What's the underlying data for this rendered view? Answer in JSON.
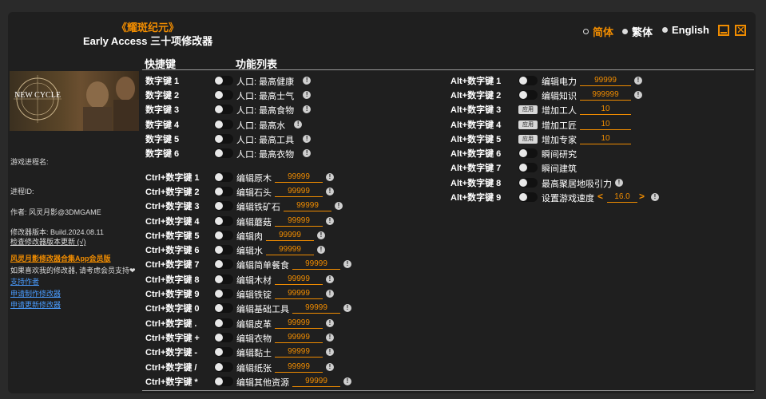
{
  "app": {
    "title_cn": "《耀斑纪元》",
    "subtitle": "Early Access 三十项修改器"
  },
  "languages": [
    {
      "label": "简体",
      "selected": true
    },
    {
      "label": "繁体",
      "selected": false
    },
    {
      "label": "English",
      "selected": false
    }
  ],
  "headers": {
    "hotkey": "快捷键",
    "features": "功能列表"
  },
  "cover": {
    "text": "NEW CYCLE"
  },
  "sidebar": {
    "process_name": "游戏进程名:",
    "process_id": "进程ID:",
    "author": "作者: 风灵月影@3DMGAME",
    "version": "修改器版本: Build.2024.08.11",
    "check_update": "检查修改器版本更新 (√)",
    "app_link": "风灵月影修改器合集App会员版",
    "support_text": "如果喜欢我的修改器, 请考虑会员支持❤",
    "support_author": "支持作者",
    "request_trainer": "申请制作修改器",
    "request_update": "申请更新修改器"
  },
  "left_rows": [
    {
      "key": "数字键 1",
      "name": "人口: 最高健康"
    },
    {
      "key": "数字键 2",
      "name": "人口: 最高士气"
    },
    {
      "key": "数字键 3",
      "name": "人口: 最高食物"
    },
    {
      "key": "数字键 4",
      "name": "人口: 最高水"
    },
    {
      "key": "数字键 5",
      "name": "人口: 最高工具"
    },
    {
      "key": "数字键 6",
      "name": "人口: 最高衣物"
    },
    {
      "key": "Ctrl+数字键 1",
      "name": "编辑原木",
      "value": "99999"
    },
    {
      "key": "Ctrl+数字键 2",
      "name": "编辑石头",
      "value": "99999"
    },
    {
      "key": "Ctrl+数字键 3",
      "name": "编辑铁矿石",
      "value": "99999"
    },
    {
      "key": "Ctrl+数字键 4",
      "name": "编辑蘑菇",
      "value": "99999"
    },
    {
      "key": "Ctrl+数字键 5",
      "name": "编辑肉",
      "value": "99999"
    },
    {
      "key": "Ctrl+数字键 6",
      "name": "编辑水",
      "value": "99999"
    },
    {
      "key": "Ctrl+数字键 7",
      "name": "编辑简单餐食",
      "value": "99999"
    },
    {
      "key": "Ctrl+数字键 8",
      "name": "编辑木材",
      "value": "99999"
    },
    {
      "key": "Ctrl+数字键 9",
      "name": "编辑铁锭",
      "value": "99999"
    },
    {
      "key": "Ctrl+数字键 0",
      "name": "编辑基础工具",
      "value": "99999"
    },
    {
      "key": "Ctrl+数字键 .",
      "name": "编辑皮革",
      "value": "99999"
    },
    {
      "key": "Ctrl+数字键 +",
      "name": "编辑衣物",
      "value": "99999"
    },
    {
      "key": "Ctrl+数字键 -",
      "name": "编辑黏土",
      "value": "99999"
    },
    {
      "key": "Ctrl+数字键 /",
      "name": "编辑纸张",
      "value": "99999"
    },
    {
      "key": "Ctrl+数字键 *",
      "name": "编辑其他资源",
      "value": "99999"
    }
  ],
  "right_rows": [
    {
      "key": "Alt+数字键 1",
      "name": "编辑电力",
      "value": "99999"
    },
    {
      "key": "Alt+数字键 2",
      "name": "编辑知识",
      "value": "999999"
    },
    {
      "key": "Alt+数字键 3",
      "name": "增加工人",
      "value": "10",
      "apply": "应用"
    },
    {
      "key": "Alt+数字键 4",
      "name": "增加工匠",
      "value": "10",
      "apply": "应用"
    },
    {
      "key": "Alt+数字键 5",
      "name": "增加专家",
      "value": "10",
      "apply": "应用"
    },
    {
      "key": "Alt+数字键 6",
      "name": "瞬间研究"
    },
    {
      "key": "Alt+数字键 7",
      "name": "瞬间建筑"
    },
    {
      "key": "Alt+数字键 8",
      "name": "最高聚居地吸引力"
    },
    {
      "key": "Alt+数字键 9",
      "name": "设置游戏速度",
      "value": "16.0"
    }
  ],
  "colors": {
    "accent": "#f08c00",
    "background": "#1f1f1f",
    "link": "#4a9cff"
  }
}
